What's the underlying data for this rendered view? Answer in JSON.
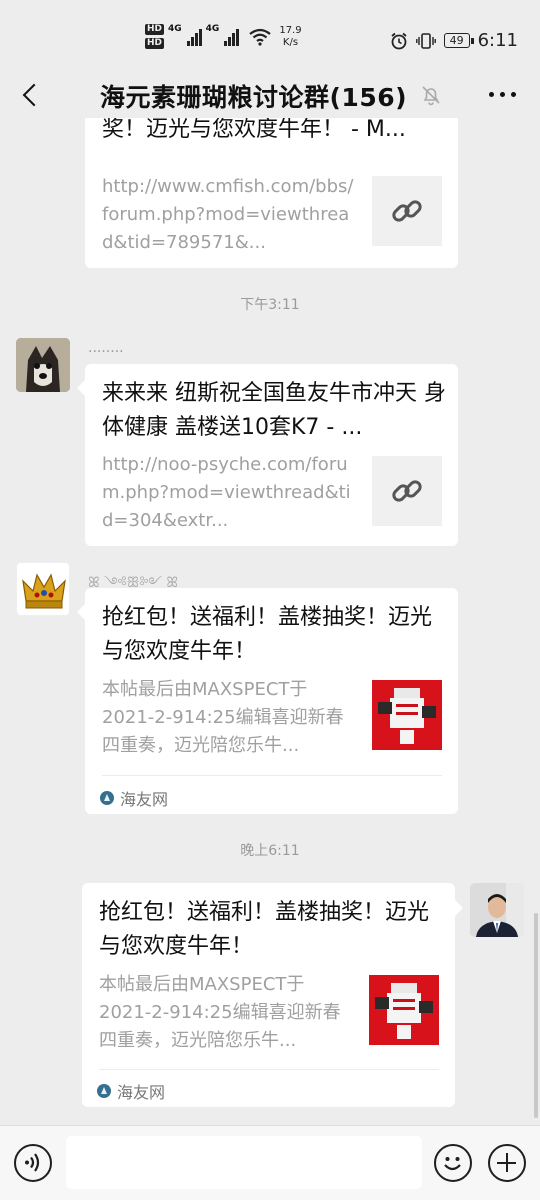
{
  "status_bar": {
    "hd_top": "HD",
    "hd_bottom": "HD",
    "net1": "4G",
    "net2": "4G",
    "speed_value": "17.9",
    "speed_unit": "K/s",
    "battery": "49",
    "time": "6:11"
  },
  "nav": {
    "title": "海元素珊瑚粮讨论群(156)"
  },
  "messages": [
    {
      "title": "抢红包！送福利！盖楼抽奖！迈光与您欢度牛年！ - M...",
      "title_visible": "奖！迈光与您欢度牛年！ - M...",
      "description": "http://www.cmfish.com/bbs/forum.php?mod=viewthread&tid=789571&..."
    },
    {
      "timestamp": "下午3:11",
      "sender": "........",
      "title": "来来来 纽斯祝全国鱼友牛市冲天 身体健康 盖楼送10套K7 - ...",
      "description": "http://noo-psyche.com/forum.php?mod=viewthread&tid=304&extr..."
    },
    {
      "sender": "ꕤ ༺ꕥ༻ ꕤ",
      "title": "抢红包！送福利！盖楼抽奖！迈光与您欢度牛年！",
      "description": "本帖最后由MAXSPECT于2021-2-914:25编辑喜迎新春四重奏，迈光陪您乐牛...",
      "source": "海友网"
    },
    {
      "timestamp": "晚上6:11",
      "title": "抢红包！送福利！盖楼抽奖！迈光与您欢度牛年！",
      "description": "本帖最后由MAXSPECT于2021-2-914:25编辑喜迎新春四重奏，迈光陪您乐牛...",
      "source": "海友网"
    }
  ],
  "input": {
    "value": ""
  },
  "colors": {
    "background": "#ededed",
    "card": "#ffffff",
    "muted_text": "#a0a0a0",
    "thumb_red": "#d8121b"
  }
}
